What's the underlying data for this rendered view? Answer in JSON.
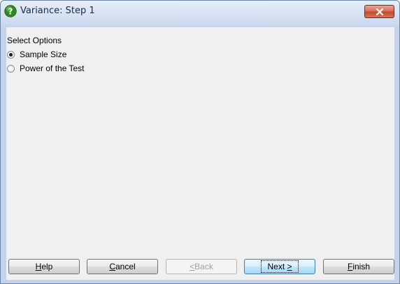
{
  "window": {
    "title": "Variance: Step 1"
  },
  "options": {
    "group_label": "Select Options",
    "items": [
      {
        "label": "Sample Size",
        "checked": true
      },
      {
        "label": "Power of the Test",
        "checked": false
      }
    ]
  },
  "buttons": {
    "help": {
      "mnemonic": "H",
      "rest": "elp"
    },
    "cancel": {
      "mnemonic": "C",
      "rest": "ancel"
    },
    "back": {
      "mnemonic": "<",
      "rest": " Back"
    },
    "next": {
      "text": "Next ",
      "mnemonic": ">"
    },
    "finish": {
      "mnemonic": "F",
      "rest": "inish"
    }
  },
  "colors": {
    "help_icon_green": "#2e8b1e",
    "close_red": "#c64a2e"
  }
}
